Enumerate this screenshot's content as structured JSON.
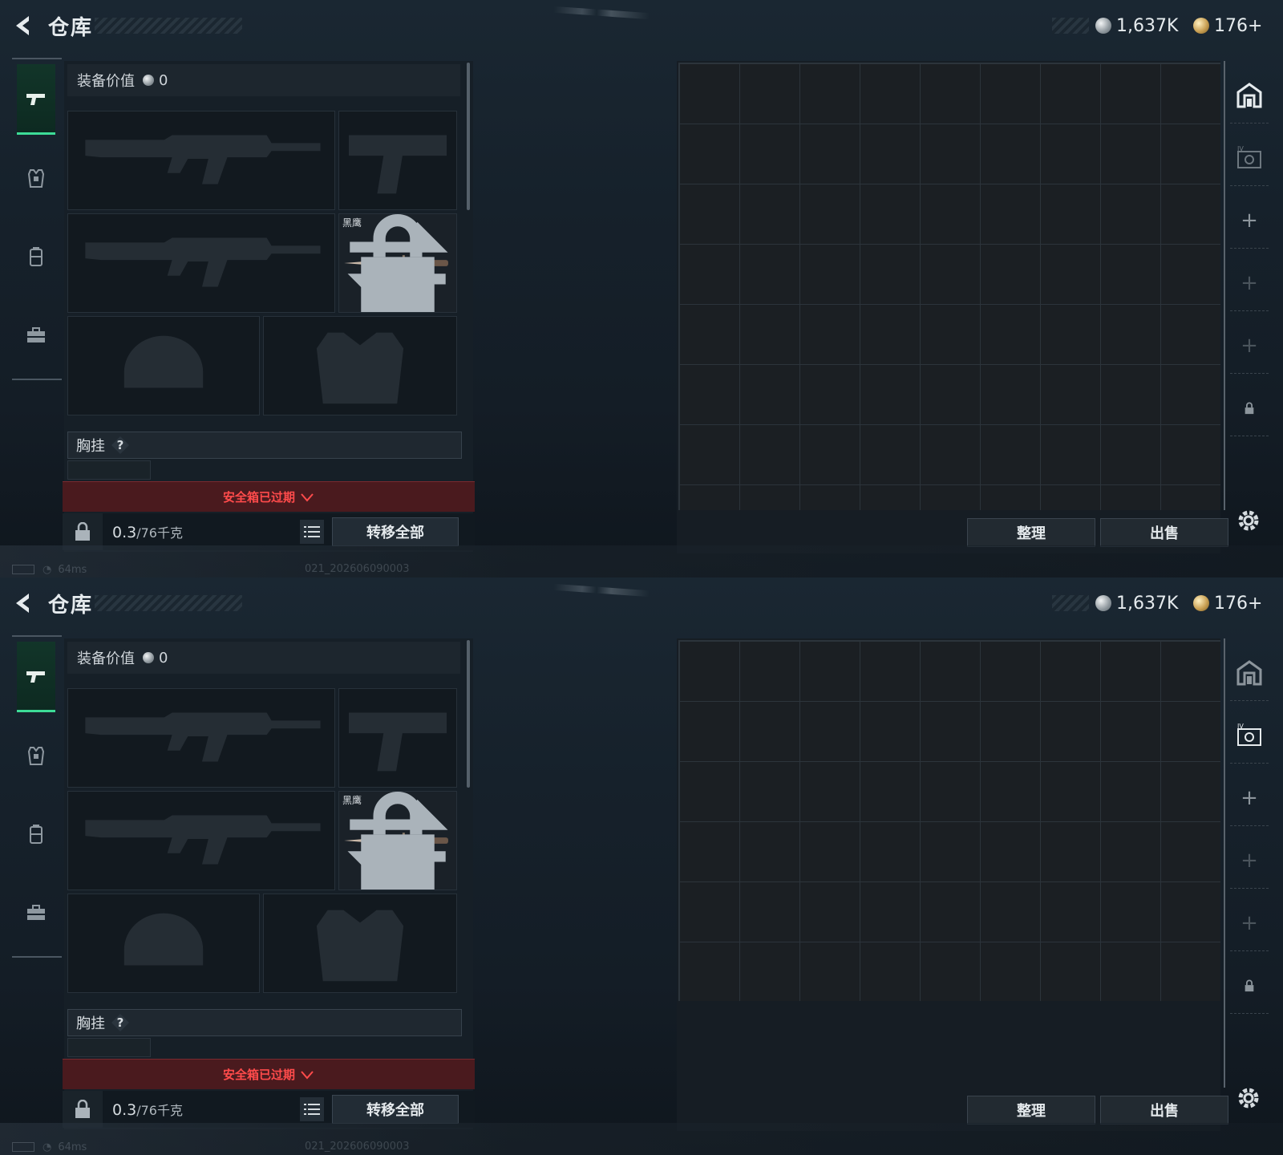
{
  "header": {
    "title": "仓库"
  },
  "currency": {
    "silver": "1,637K",
    "gold": "176+"
  },
  "nav": {
    "items": [
      {
        "icon": "pistol-icon",
        "active": true
      },
      {
        "icon": "armor-vest-icon",
        "active": false
      },
      {
        "icon": "backpack-icon",
        "active": false
      },
      {
        "icon": "toolbox-icon",
        "active": false
      }
    ]
  },
  "equipment": {
    "value_label": "装备价值",
    "value": "0",
    "melee_name": "黑鹰",
    "chest_rig_label": "胸挂",
    "chest_rig_help": "?",
    "safebox_status": "安全箱已过期",
    "weight_current": "0.3",
    "weight_max": "/76千克",
    "transfer_all": "转移全部"
  },
  "storage": {
    "sort_label": "整理",
    "sell_label": "出售"
  },
  "status": {
    "ping": "64ms",
    "uid": "021_202606090003"
  },
  "colors": {
    "accent_green": "#3ddc97",
    "warning_red": "#ff4b4b",
    "background": "#16212b"
  }
}
